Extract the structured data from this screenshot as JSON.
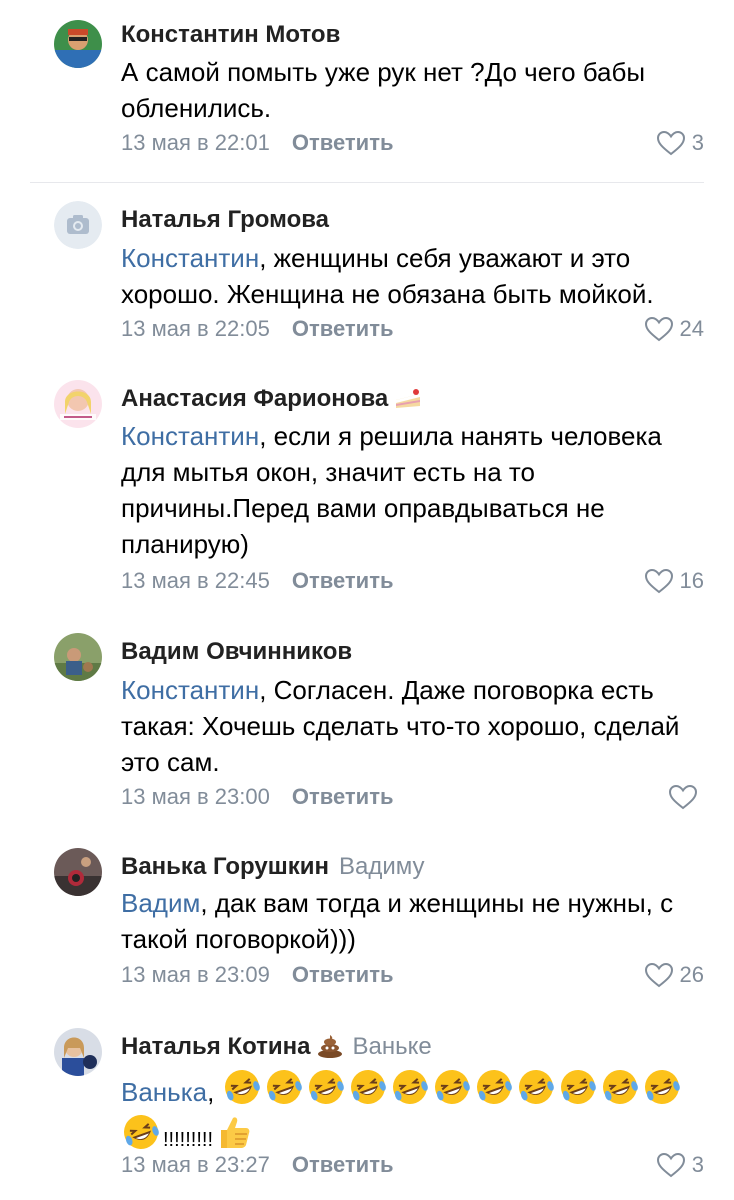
{
  "comments": [
    {
      "author": "Константин Мотов",
      "reply_to": "",
      "mention": "",
      "text": "А самой помыть уже рук нет ?До чего бабы обленились.",
      "time": "13 мая в 22:01",
      "reply_label": "Ответить",
      "likes": "3"
    },
    {
      "author": "Наталья Громова",
      "reply_to": "",
      "mention": "Константин",
      "text": ", женщины себя уважают и это хорошо. Женщина не обязана быть мойкой.",
      "time": "13 мая в 22:05",
      "reply_label": "Ответить",
      "likes": "24"
    },
    {
      "author": "Анастасия Фарионова",
      "reply_to": "",
      "mention": "Константин",
      "text": ", если я решила нанять человека для мытья окон, значит есть на то причины.Перед вами оправдываться не планирую)",
      "time": "13 мая в 22:45",
      "reply_label": "Ответить",
      "likes": "16"
    },
    {
      "author": "Вадим Овчинников",
      "reply_to": "",
      "mention": "Константин",
      "text": ", Согласен. Даже поговорка есть такая: Хочешь сделать что-то хорошо, сделай это сам.",
      "time": "13 мая в 23:00",
      "reply_label": "Ответить",
      "likes": ""
    },
    {
      "author": "Ванька Горушкин",
      "reply_to": "Вадиму",
      "mention": "Вадим",
      "text": ", дак вам тогда и женщины не нужны, с такой поговоркой)))",
      "time": "13 мая в 23:09",
      "reply_label": "Ответить",
      "likes": "26"
    },
    {
      "author": "Наталья Котина",
      "reply_to": "Ваньке",
      "mention": "Ванька",
      "text_prefix": ",",
      "text_exclaim": "!!!!!!!!!",
      "time": "13 мая в 23:27",
      "reply_label": "Ответить",
      "likes": "3"
    }
  ],
  "icons": {
    "like": "heart-outline-icon",
    "laugh": "rolling-on-floor-laughing-emoji",
    "thumbs": "thumbs-up-emoji",
    "cake": "cake-emoji",
    "poop": "pile-of-poo-emoji",
    "camera": "camera-icon"
  },
  "colors": {
    "link": "#3f6ea4",
    "secondary": "#818c99",
    "divider": "#e7e8ec"
  }
}
